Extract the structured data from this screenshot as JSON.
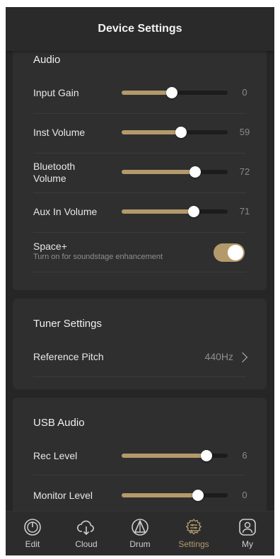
{
  "header": {
    "title": "Device Settings"
  },
  "audio": {
    "title": "Audio",
    "rows": [
      {
        "label": "Input Gain",
        "value": "0",
        "level": 0.47
      },
      {
        "label": "Inst Volume",
        "value": "59",
        "level": 0.56
      },
      {
        "label": "Bluetooth Volume",
        "value": "72",
        "level": 0.69
      },
      {
        "label": "Aux In Volume",
        "value": "71",
        "level": 0.68
      }
    ],
    "space_plus": {
      "label": "Space+",
      "description": "Turn on for soundstage enhancement",
      "enabled": true
    }
  },
  "tuner": {
    "title": "Tuner Settings",
    "reference_pitch": {
      "label": "Reference Pitch",
      "value": "440Hz"
    }
  },
  "usb_audio": {
    "title": "USB Audio",
    "rows": [
      {
        "label": "Rec Level",
        "value": "6",
        "level": 0.8
      },
      {
        "label": "Monitor Level",
        "value": "0",
        "level": 0.72
      }
    ]
  },
  "tabbar": {
    "items": [
      {
        "label": "Edit",
        "icon": "knob-icon",
        "active": false
      },
      {
        "label": "Cloud",
        "icon": "cloud-download-icon",
        "active": false
      },
      {
        "label": "Drum",
        "icon": "drum-icon",
        "active": false
      },
      {
        "label": "Settings",
        "icon": "gear-sliders-icon",
        "active": true
      },
      {
        "label": "My",
        "icon": "user-icon",
        "active": false
      }
    ]
  },
  "colors": {
    "accent": "#b49a6b",
    "background": "#262626",
    "card": "#2f2f2f"
  }
}
